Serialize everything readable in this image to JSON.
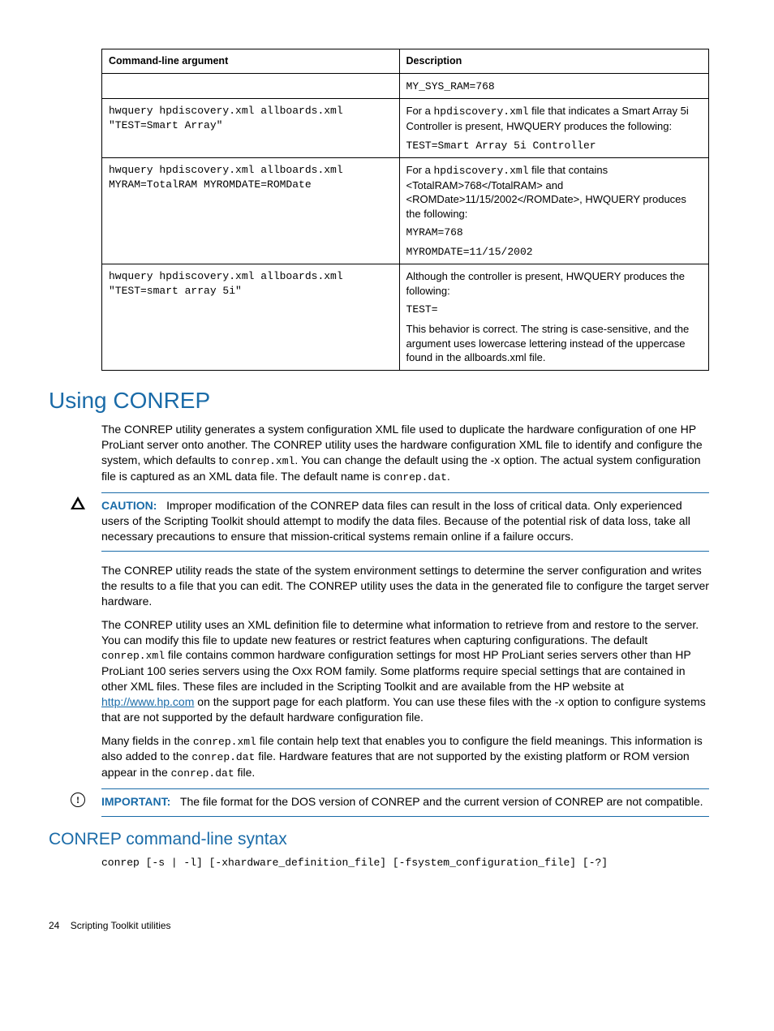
{
  "table": {
    "headers": [
      "Command-line argument",
      "Description"
    ],
    "rows": [
      {
        "arg": "",
        "desc_code1": "MY_SYS_RAM=768"
      },
      {
        "arg": "hwquery hpdiscovery.xml allboards.xml \"TEST=Smart Array\"",
        "desc_p1a": "For a ",
        "desc_p1code": "hpdiscovery.xml",
        "desc_p1b": " file that indicates a Smart Array 5i Controller is present, HWQUERY produces the following:",
        "desc_code1": "TEST=Smart Array 5i Controller"
      },
      {
        "arg": "hwquery hpdiscovery.xml allboards.xml MYRAM=TotalRAM MYROMDATE=ROMDate",
        "desc_p1a": "For a ",
        "desc_p1code": "hpdiscovery.xml",
        "desc_p1b": " file that contains <TotalRAM>768</TotalRAM> and <ROMDate>11/15/2002</ROMDate>, HWQUERY produces the following:",
        "desc_code1": "MYRAM=768",
        "desc_code2": "MYROMDATE=11/15/2002"
      },
      {
        "arg": "hwquery hpdiscovery.xml allboards.xml \"TEST=smart array 5i\"",
        "desc_p1": "Although the controller is present, HWQUERY produces the following:",
        "desc_code1": "TEST=",
        "desc_p2": "This behavior is correct. The string is case-sensitive, and the argument uses lowercase lettering instead of the uppercase found in the allboards.xml file."
      }
    ]
  },
  "h1": "Using CONREP",
  "p1a": "The CONREP utility generates a system configuration XML file used to duplicate the hardware configuration of one HP ProLiant server onto another. The CONREP utility uses the hardware configuration XML file to identify and configure the system, which defaults to ",
  "p1code1": "conrep.xml",
  "p1b": ". You can change the default using the -x option. The actual system configuration file is captured as an XML data file. The default name is ",
  "p1code2": "conrep.dat",
  "p1c": ".",
  "caution": {
    "label": "CAUTION:",
    "text": "Improper modification of the CONREP data files can result in the loss of critical data. Only experienced users of the Scripting Toolkit should attempt to modify the data files. Because of the potential risk of data loss, take all necessary precautions to ensure that mission-critical systems remain online if a failure occurs."
  },
  "p2": "The CONREP utility reads the state of the system environment settings to determine the server configuration and writes the results to a file that you can edit. The CONREP utility uses the data in the generated file to configure the target server hardware.",
  "p3a": "The CONREP utility uses an XML definition file to determine what information to retrieve from and restore to the server. You can modify this file to update new features or restrict features when capturing configurations. The default ",
  "p3code1": "conrep.xml",
  "p3b": " file contains common hardware configuration settings for most HP ProLiant series servers other than HP ProLiant 100 series servers using the Oxx ROM family. Some platforms require special settings that are contained in other XML files. These files are included in the Scripting Toolkit and are available from the HP website at ",
  "p3link": "http://www.hp.com",
  "p3c": " on the support page for each platform. You can use these files with the -x option to configure systems that are not supported by the default hardware configuration file.",
  "p4a": "Many fields in the ",
  "p4code1": "conrep.xml",
  "p4b": " file contain help text that enables you to configure the field meanings. This information is also added to the ",
  "p4code2": "conrep.dat",
  "p4c": " file. Hardware features that are not supported by the existing platform or ROM version appear in the ",
  "p4code3": "conrep.dat",
  "p4d": " file.",
  "important": {
    "label": "IMPORTANT:",
    "text": "The file format for the DOS version of CONREP and the current version of CONREP are not compatible."
  },
  "h2": "CONREP command-line syntax",
  "syntax": "conrep [-s | -l] [-xhardware_definition_file] [-fsystem_configuration_file] [-?]",
  "footer": {
    "page": "24",
    "title": "Scripting Toolkit utilities"
  }
}
